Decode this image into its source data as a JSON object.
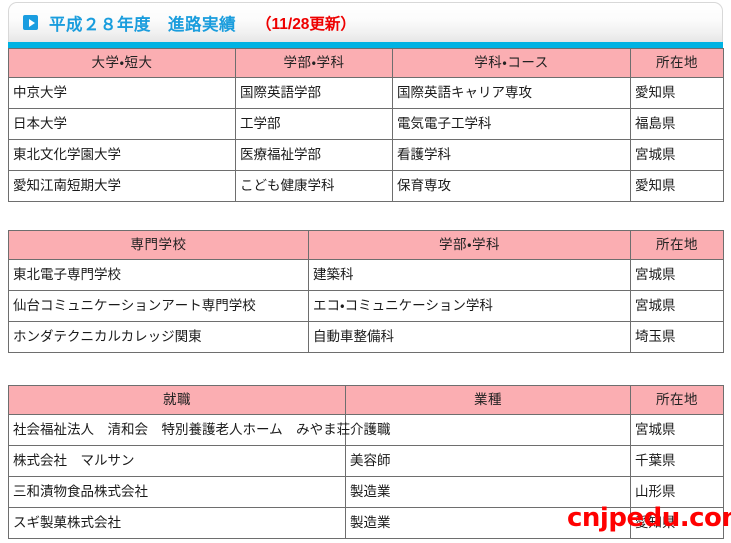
{
  "header": {
    "icon": "play-triangle-icon",
    "title": "平成２８年度　進路実績",
    "update_note": "（11/28更新）",
    "title_color": "#1a9ddd",
    "update_color": "#ee0000",
    "rule_color": "#00b3e3"
  },
  "theme": {
    "table_header_bg": "#fbaeb2",
    "table_border": "#6e6e6e",
    "watermark_color": "#ff0000"
  },
  "tables": [
    {
      "id": "schools",
      "columns": [
        "大学・短大",
        "学部・学科",
        "学科・コース",
        "所在地"
      ],
      "rows": [
        [
          "中京大学",
          "国際英語学部",
          "国際英語キャリア専攻",
          "愛知県"
        ],
        [
          "日本大学",
          "工学部",
          "電気電子工学科",
          "福島県"
        ],
        [
          "東北文化学園大学",
          "医療福祉学部",
          "看護学科",
          "宮城県"
        ],
        [
          "愛知江南短期大学",
          "こども健康学科",
          "保育専攻",
          "愛知県"
        ]
      ]
    },
    {
      "id": "vocational",
      "columns": [
        "専門学校",
        "学部・学科",
        "所在地"
      ],
      "rows": [
        [
          "東北電子専門学校",
          "建築科",
          "宮城県"
        ],
        [
          "仙台コミュニケーションアート専門学校",
          "エコ・コミュニケーション学科",
          "宮城県"
        ],
        [
          "ホンダテクニカルカレッジ関東",
          "自動車整備科",
          "埼玉県"
        ]
      ]
    },
    {
      "id": "employment",
      "columns": [
        "就職",
        "業種",
        "所在地"
      ],
      "rows": [
        [
          "社会福祉法人　清和会　特別養護老人ホーム　みやま荘",
          "介護職",
          "宮城県"
        ],
        [
          "株式会社　マルサン",
          "美容師",
          "千葉県"
        ],
        [
          "三和漬物食品株式会社",
          "製造業",
          "山形県"
        ],
        [
          "スギ製菓株式会社",
          "製造業",
          "愛知県"
        ]
      ]
    }
  ],
  "watermark": {
    "text": "cnjpedu.com"
  }
}
